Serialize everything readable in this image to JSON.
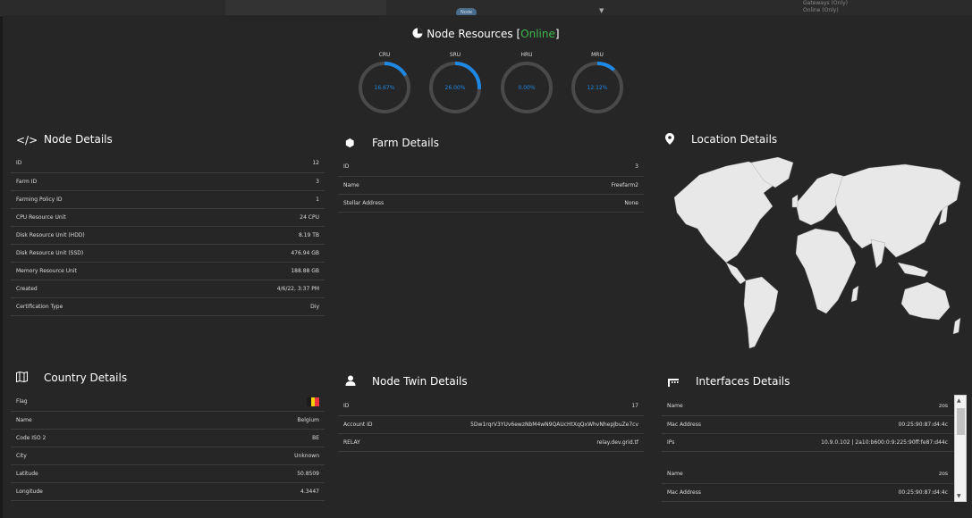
{
  "topbar": {
    "chip_label": "Node ID",
    "right_item_1": "Gateways (Only)",
    "right_item_2": "Online (Only)"
  },
  "resources": {
    "title": "Node Resources",
    "status": "Online",
    "gauges": [
      {
        "label": "CRU",
        "value_text": "16.67%",
        "value": 16.67
      },
      {
        "label": "SRU",
        "value_text": "26.00%",
        "value": 26.0
      },
      {
        "label": "HRU",
        "value_text": "0.00%",
        "value": 0
      },
      {
        "label": "MRU",
        "value_text": "12.12%",
        "value": 12.12
      }
    ]
  },
  "node_details": {
    "title": "Node Details",
    "rows": [
      {
        "k": "ID",
        "v": "12"
      },
      {
        "k": "Farm ID",
        "v": "3"
      },
      {
        "k": "Farming Policy ID",
        "v": "1"
      },
      {
        "k": "CPU Resource Unit",
        "v": "24 CPU"
      },
      {
        "k": "Disk Resource Unit (HDD)",
        "v": "8.19 TB"
      },
      {
        "k": "Disk Resource Unit (SSD)",
        "v": "476.94 GB"
      },
      {
        "k": "Memory Resource Unit",
        "v": "188.88 GB"
      },
      {
        "k": "Created",
        "v": "4/6/22, 3:37 PM"
      },
      {
        "k": "Certification Type",
        "v": "Diy"
      }
    ]
  },
  "farm_details": {
    "title": "Farm Details",
    "rows": [
      {
        "k": "ID",
        "v": "3"
      },
      {
        "k": "Name",
        "v": "Freefarm2"
      },
      {
        "k": "Stellar Address",
        "v": "None"
      }
    ]
  },
  "location_details": {
    "title": "Location Details"
  },
  "country_details": {
    "title": "Country Details",
    "flag_label": "Flag",
    "flag_colors": [
      "#1a1a1a",
      "#f5d000",
      "#ef3340"
    ],
    "rows": [
      {
        "k": "Name",
        "v": "Belgium"
      },
      {
        "k": "Code ISO 2",
        "v": "BE"
      },
      {
        "k": "City",
        "v": "Unknown"
      },
      {
        "k": "Latitude",
        "v": "50.8509"
      },
      {
        "k": "Longitude",
        "v": "4.3447"
      }
    ]
  },
  "twin_details": {
    "title": "Node Twin Details",
    "rows": [
      {
        "k": "ID",
        "v": "17"
      },
      {
        "k": "Account ID",
        "v": "5Dw1rqrV3YUv6ewzNbM4wN9QAUcHtXqQxWhvNhepJbuZe7cv"
      },
      {
        "k": "RELAY",
        "v": "relay.dev.grid.tf"
      }
    ]
  },
  "interfaces_details": {
    "title": "Interfaces Details",
    "groups": [
      [
        {
          "k": "Name",
          "v": "zos"
        },
        {
          "k": "Mac Address",
          "v": "00:25:90:87:d4:4c"
        },
        {
          "k": "IPs",
          "v": "10.9.0.102 | 2a10:b600:0:9:225:90ff:fe87:d44c"
        }
      ],
      [
        {
          "k": "Name",
          "v": "zos"
        },
        {
          "k": "Mac Address",
          "v": "00:25:90:87:d4:4c"
        }
      ]
    ]
  },
  "colors": {
    "accent": "#1e88e5",
    "online": "#3fb950",
    "ring": "#4a4a4a"
  }
}
